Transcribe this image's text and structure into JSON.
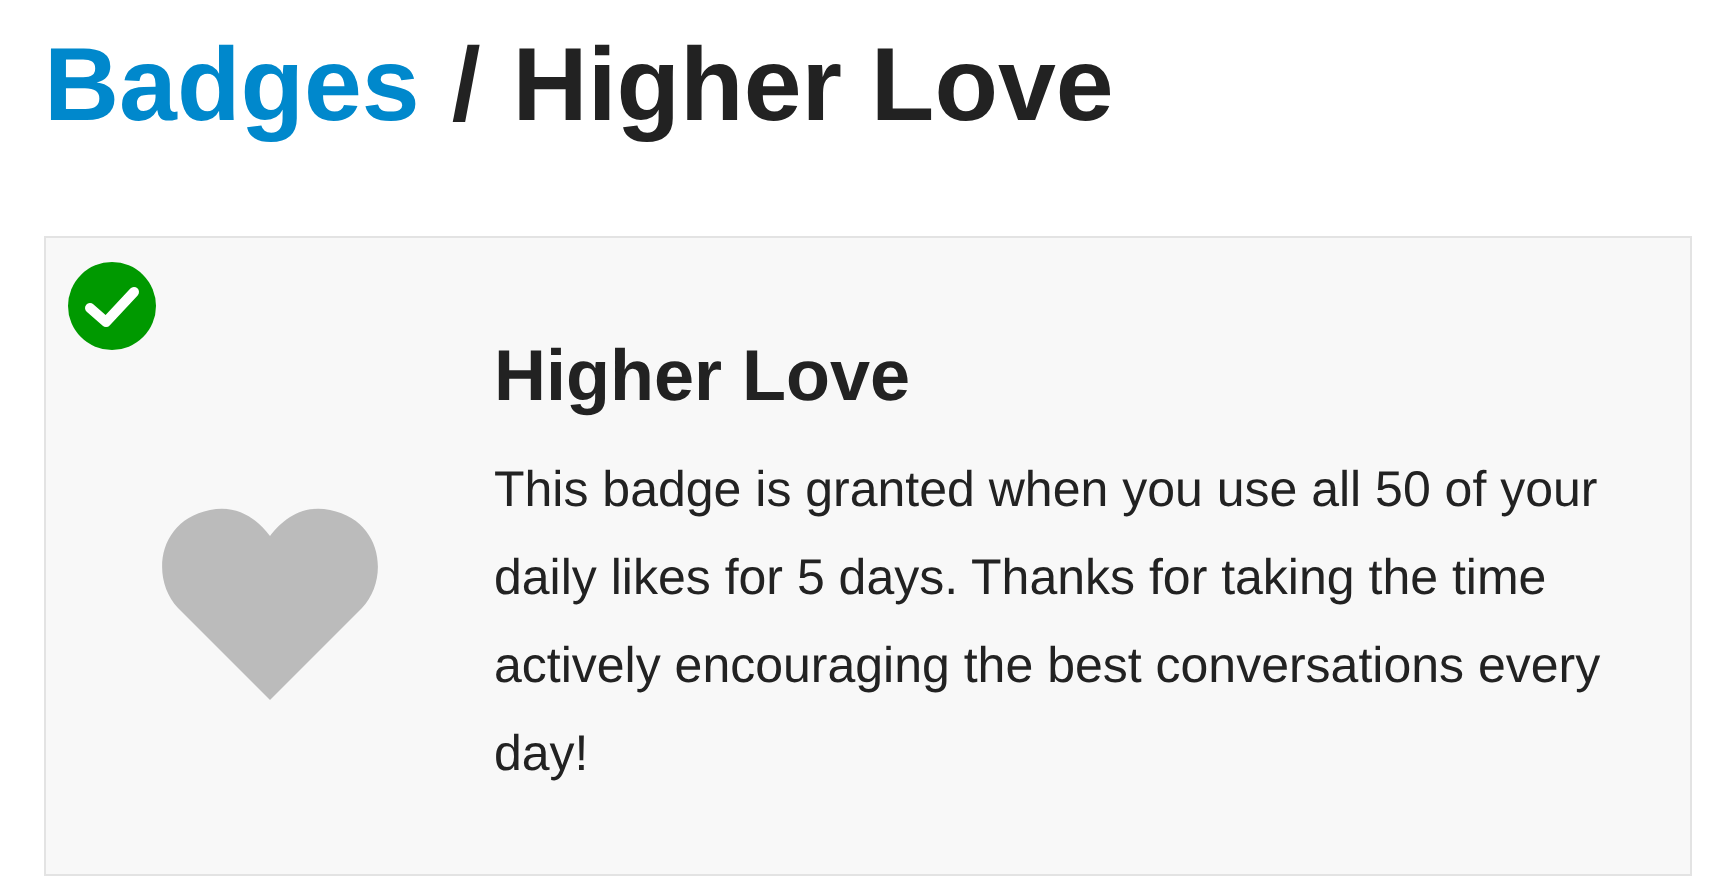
{
  "breadcrumb": {
    "parent": "Badges",
    "separator": "/",
    "current": "Higher Love"
  },
  "badge": {
    "granted": true,
    "name": "Higher Love",
    "description": "This badge is granted when you use all 50 of your daily likes for 5 days. Thanks for taking the time actively encouraging the best conversations every day!"
  }
}
